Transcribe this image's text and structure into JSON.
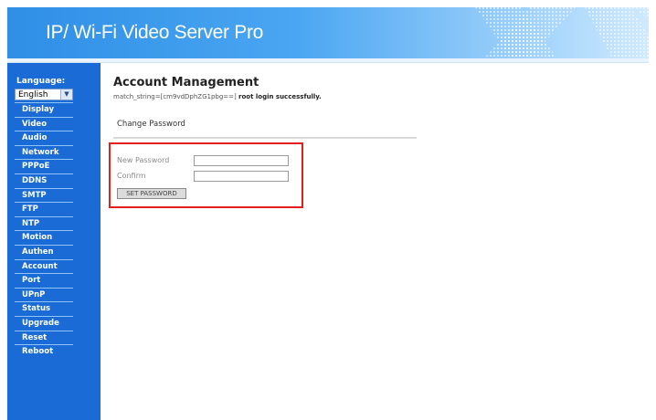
{
  "header": {
    "title": "IP/ Wi-Fi Video Server Pro"
  },
  "sidebar": {
    "language_label": "Language:",
    "language_value": "English",
    "items": [
      "Display",
      "Video",
      "Audio",
      "Network",
      "PPPoE",
      "DDNS",
      "SMTP",
      "FTP",
      "NTP",
      "Motion",
      "Authen",
      "Account",
      "Port",
      "UPnP",
      "Status",
      "Upgrade",
      "Reset",
      "Reboot"
    ]
  },
  "main": {
    "title": "Account Management",
    "login_prefix": "match_string=[cm9vdDphZG1pbg==]",
    "login_suffix": "root login successfully.",
    "section_title": "Change Password",
    "new_password_label": "New Password",
    "confirm_label": "Confirm",
    "new_password_value": "",
    "confirm_value": "",
    "set_password_button": "SET PASSWORD"
  },
  "colors": {
    "sidebar": "#1a6bd6",
    "highlight_box": "#e51e1e"
  },
  "icons": {
    "select_arrow": "chevron-down-icon"
  }
}
